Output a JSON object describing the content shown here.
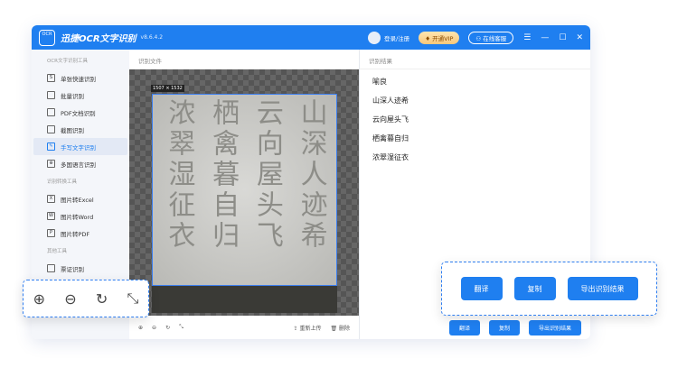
{
  "app": {
    "title": "迅捷OCR文字识别",
    "version": "v8.6.4.2",
    "logo_text": "OCR",
    "login": "登录/注册",
    "vip": "开通VIP",
    "service": "在线客服"
  },
  "sidebar": {
    "sections": [
      {
        "title": "OCR文字识别工具",
        "items": [
          {
            "label": "单张快速识别",
            "icon": "S"
          },
          {
            "label": "批量识别",
            "icon": ""
          },
          {
            "label": "PDF文档识别",
            "icon": ""
          },
          {
            "label": "截图识别",
            "icon": ""
          },
          {
            "label": "手写文字识别",
            "icon": "✎",
            "active": true
          },
          {
            "label": "多国语言识别",
            "icon": "⊕"
          }
        ]
      },
      {
        "title": "识别转换工具",
        "items": [
          {
            "label": "图片转Excel",
            "icon": "X"
          },
          {
            "label": "图片转Word",
            "icon": "W"
          },
          {
            "label": "图片转PDF",
            "icon": "P"
          }
        ]
      },
      {
        "title": "其他工具",
        "items": [
          {
            "label": "票证识别",
            "icon": ""
          }
        ]
      }
    ]
  },
  "file_panel": {
    "header": "识别文件",
    "image_size": "1507 × 1532",
    "columns": [
      "山深人迹希",
      "云向屋头飞",
      "栖禽暮自归",
      "浓翠湿征衣"
    ],
    "reupload": "重新上传",
    "delete": "删除"
  },
  "result_panel": {
    "header": "识别结果",
    "lines": [
      "喻良",
      "山深人迹希",
      "云向屋头飞",
      "栖禽暮自归",
      "浓翠湿征衣"
    ],
    "translate": "翻译",
    "copy": "复制",
    "export": "导出识别结果"
  },
  "accent": "#1f7ff0"
}
